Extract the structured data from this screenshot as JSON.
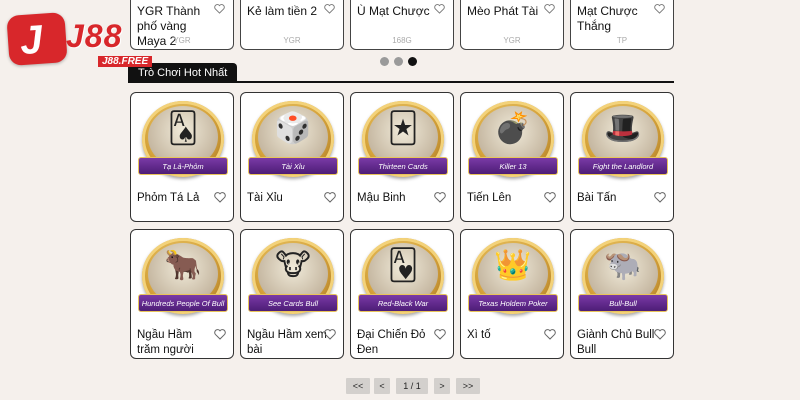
{
  "logo": {
    "text": "J88",
    "mark": "J",
    "sub": "J88.FREE"
  },
  "top_games": [
    {
      "name": "YGR Thành phố vàng Maya 2",
      "provider": "YGR"
    },
    {
      "name": "Kẻ làm tiền 2",
      "provider": "YGR"
    },
    {
      "name": "Ù Mạt Chược",
      "provider": "168G"
    },
    {
      "name": "Mèo Phát Tài",
      "provider": "YGR"
    },
    {
      "name": "Mạt Chược Thắng",
      "provider": "TP"
    }
  ],
  "section": {
    "title": "Trò Chơi Hot Nhất"
  },
  "games": [
    {
      "name": "Phỏm Tá Lả",
      "art_label": "Tạ Lả-Phỏm",
      "glyph": "🂡"
    },
    {
      "name": "Tài Xỉu",
      "art_label": "Tài Xỉu",
      "glyph": "🎲"
    },
    {
      "name": "Mậu Binh",
      "art_label": "Thirteen Cards",
      "glyph": "🃏"
    },
    {
      "name": "Tiến Lên",
      "art_label": "Killer 13",
      "glyph": "💣"
    },
    {
      "name": "Bài Tấn",
      "art_label": "Fight the Landlord",
      "glyph": "🎩"
    },
    {
      "name": "Ngầu Hầm trăm người",
      "art_label": "Hundreds People Of Bull",
      "glyph": "🐂"
    },
    {
      "name": "Ngầu Hầm xem bài",
      "art_label": "See Cards Bull",
      "glyph": "🐮"
    },
    {
      "name": "Đại Chiến Đỏ Đen",
      "art_label": "Red-Black War",
      "glyph": "🂱"
    },
    {
      "name": "Xì tố",
      "art_label": "Texas Holdem Poker",
      "glyph": "👑"
    },
    {
      "name": "Giành Chủ Bull Bull",
      "art_label": "Bull-Bull",
      "glyph": "🐃"
    }
  ],
  "pagination": {
    "first": "<<",
    "prev": "<",
    "current": "1 / 1",
    "next": ">",
    "last": ">>"
  },
  "colors": {
    "background": "#f5f0ec",
    "brand_red": "#d8272b",
    "ribbon_purple": "#5e2a8a",
    "gold": "#d5a23a"
  },
  "carousel": {
    "dot_count": 3,
    "active_dot": 3
  }
}
